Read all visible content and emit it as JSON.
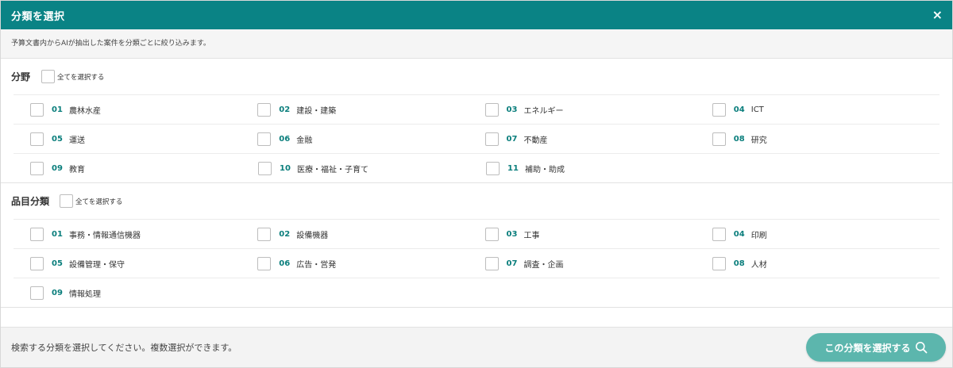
{
  "header": {
    "title": "分類を選択",
    "close_label": "×"
  },
  "description": "予算文書内からAIが抽出した案件を分類ごとに絞り込みます。",
  "fields": {
    "title": "分野",
    "select_all_label": "全てを選択する",
    "items": [
      {
        "code": "01",
        "name": "農林水産"
      },
      {
        "code": "02",
        "name": "建設・建築"
      },
      {
        "code": "03",
        "name": "エネルギー"
      },
      {
        "code": "04",
        "name": "ICT"
      },
      {
        "code": "05",
        "name": "運送"
      },
      {
        "code": "06",
        "name": "金融"
      },
      {
        "code": "07",
        "name": "不動産"
      },
      {
        "code": "08",
        "name": "研究"
      },
      {
        "code": "09",
        "name": "教育"
      },
      {
        "code": "10",
        "name": "医療・福祉・子育て"
      },
      {
        "code": "11",
        "name": "補助・助成"
      }
    ]
  },
  "item_categories": {
    "title": "品目分類",
    "select_all_label": "全てを選択する",
    "items": [
      {
        "code": "01",
        "name": "事務・情報通信機器"
      },
      {
        "code": "02",
        "name": "設備機器"
      },
      {
        "code": "03",
        "name": "工事"
      },
      {
        "code": "04",
        "name": "印刷"
      },
      {
        "code": "05",
        "name": "設備管理・保守"
      },
      {
        "code": "06",
        "name": "広告・営発"
      },
      {
        "code": "07",
        "name": "調査・企画"
      },
      {
        "code": "08",
        "name": "人材"
      },
      {
        "code": "09",
        "name": "情報処理"
      }
    ]
  },
  "footer": {
    "hint": "検索する分類を選択してください。複数選択ができます。",
    "submit_label": "この分類を選択する"
  },
  "colors": {
    "header_bg": "#0a8385",
    "accent": "#0a7e7c",
    "button_bg": "#5cb6ad"
  },
  "icons": {
    "close": "close-icon",
    "submit": "search-icon"
  }
}
